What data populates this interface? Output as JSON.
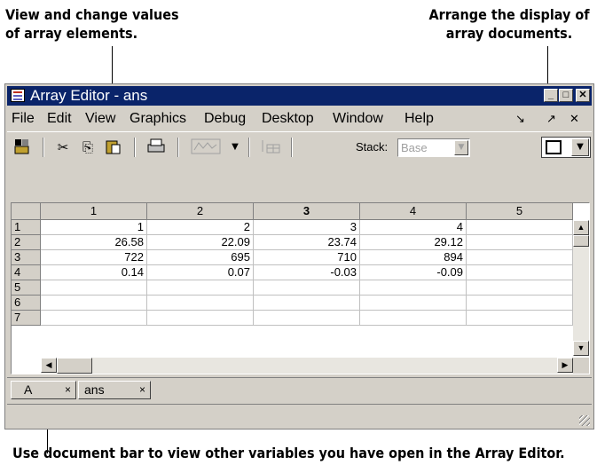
{
  "callouts": {
    "top_left_1": "View and change values",
    "top_left_2": "of array elements.",
    "top_right_1": "Arrange the display of",
    "top_right_2": "array documents.",
    "bottom": "Use document bar to view other variables you have open in the Array Editor."
  },
  "window": {
    "title": "Array Editor - ans",
    "icon": "array-editor-icon",
    "controls": {
      "minimize": "_",
      "maximize": "□",
      "close": "✕"
    }
  },
  "menu": {
    "items": [
      "File",
      "Edit",
      "View",
      "Graphics",
      "Debug",
      "Desktop",
      "Window",
      "Help"
    ],
    "undock": "↘",
    "dock_out": "↗",
    "close": "✕"
  },
  "toolbar": {
    "stack_label": "Stack:",
    "stack_value": "Base",
    "icons": [
      "import-data-icon",
      "cut-icon",
      "copy-icon",
      "paste-icon",
      "print-icon",
      "plot-icon",
      "plot-dropdown-icon",
      "transpose-icon"
    ]
  },
  "grid": {
    "columns": [
      "1",
      "2",
      "3",
      "4",
      "5"
    ],
    "selected_column": "3",
    "row_headers": [
      "1",
      "2",
      "3",
      "4",
      "5",
      "6",
      "7"
    ],
    "rows": [
      [
        "1",
        "2",
        "3",
        "4",
        ""
      ],
      [
        "26.58",
        "22.09",
        "23.74",
        "29.12",
        ""
      ],
      [
        "722",
        "695",
        "710",
        "894",
        ""
      ],
      [
        "0.14",
        "0.07",
        "-0.03",
        "-0.09",
        ""
      ],
      [
        "",
        "",
        "",
        "",
        ""
      ],
      [
        "",
        "",
        "",
        "",
        ""
      ],
      [
        "",
        "",
        "",
        "",
        ""
      ]
    ]
  },
  "document_bar": {
    "tabs": [
      {
        "label": "A",
        "close": "×"
      },
      {
        "label": "ans",
        "close": "×"
      }
    ]
  }
}
